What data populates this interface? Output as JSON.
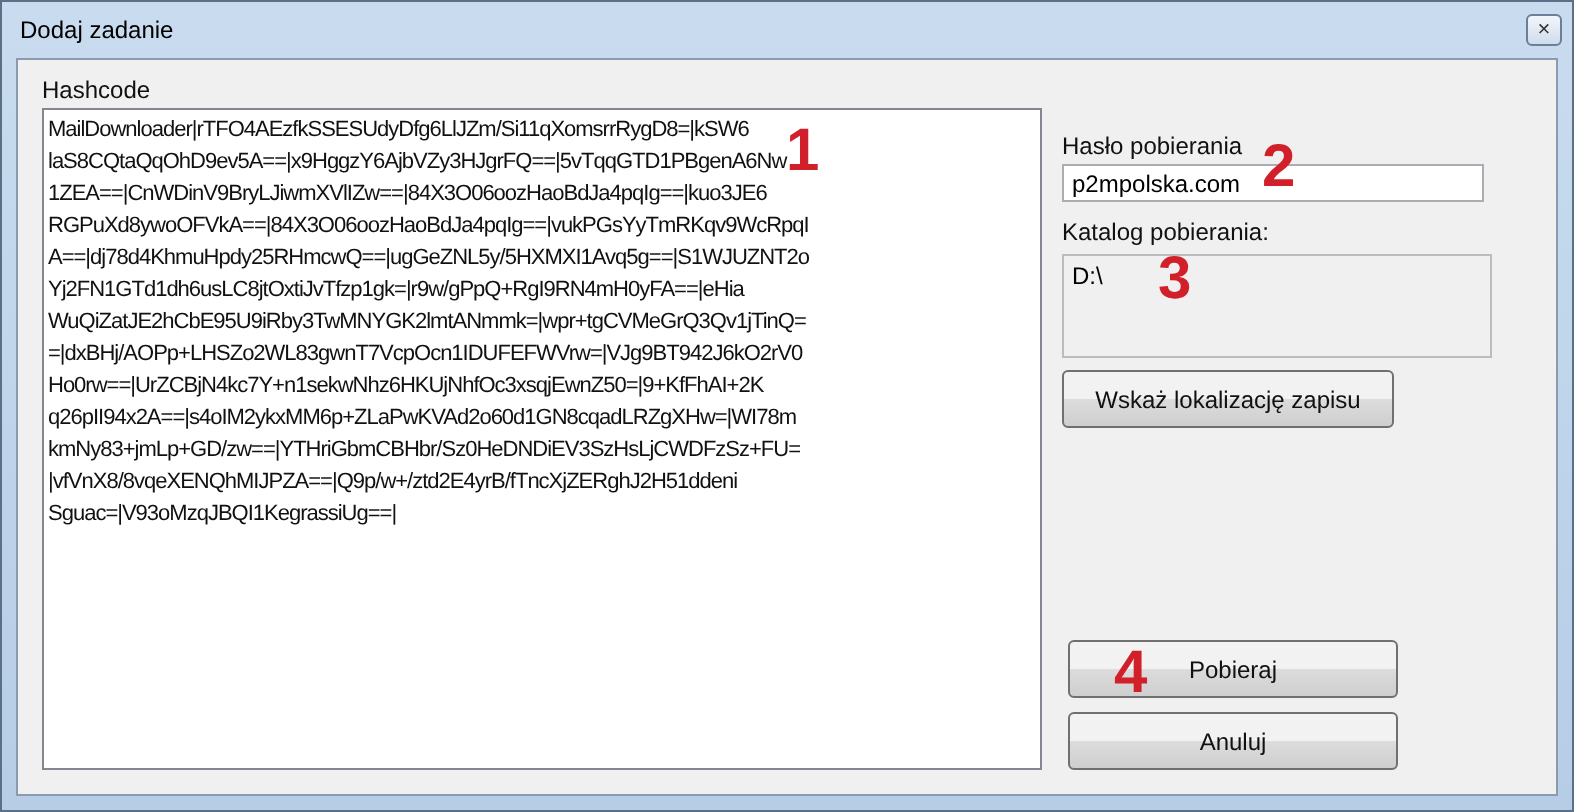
{
  "window": {
    "title": "Dodaj zadanie",
    "close": "×"
  },
  "hashcode": {
    "label": "Hashcode",
    "lines": [
      "MailDownloader|rTFO4AEzfkSSESUdyDfg6LlJZm/Si11qXomsrrRygD8=|kSW6",
      "laS8CQtaQqOhD9ev5A==|x9HggzY6AjbVZy3HJgrFQ==|5vTqqGTD1PBgenA6Nw",
      "1ZEA==|CnWDinV9BryLJiwmXVlIZw==|84X3O06oozHaoBdJa4pqIg==|kuo3JE6",
      "RGPuXd8ywoOFVkA==|84X3O06oozHaoBdJa4pqIg==|vukPGsYyTmRKqv9WcRpqI",
      "A==|dj78d4KhmuHpdy25RHmcwQ==|ugGeZNL5y/5HXMXI1Avq5g==|S1WJUZNT2o",
      "Yj2FN1GTd1dh6usLC8jtOxtiJvTfzp1gk=|r9w/gPpQ+RgI9RN4mH0yFA==|eHia",
      "WuQiZatJE2hCbE95U9iRby3TwMNYGK2lmtANmmk=|wpr+tgCVMeGrQ3Qv1jTinQ=",
      "=|dxBHj/AOPp+LHSZo2WL83gwnT7VcpOcn1IDUFEFWVrw=|VJg9BT942J6kO2rV0",
      "Ho0rw==|UrZCBjN4kc7Y+n1sekwNhz6HKUjNhfOc3xsqjEwnZ50=|9+KfFhAI+2K",
      "q26pII94x2A==|s4oIM2ykxMM6p+ZLaPwKVAd2o60d1GN8cqadLRZgXHw=|WI78m",
      "kmNy83+jmLp+GD/zw==|YTHriGbmCBHbr/Sz0HeDNDiEV3SzHsLjCWDFzSz+FU=",
      "|vfVnX8/8vqeXENQhMIJPZA==|Q9p/w+/ztd2E4yrB/fTncXjZERghJ2H51ddeni",
      "Sguac=|V93oMzqJBQI1KegrassiUg==|"
    ]
  },
  "password": {
    "label": "Hasło pobierania",
    "value": "p2mpolska.com"
  },
  "folder": {
    "label": "Katalog pobierania:",
    "value": "D:\\"
  },
  "buttons": [
    {
      "kind": "browse",
      "label": "Wskaż lokalizację zapisu"
    },
    {
      "kind": "download",
      "label": "Pobieraj"
    },
    {
      "kind": "cancel",
      "label": "Anuluj"
    }
  ],
  "annotations": [
    "1",
    "2",
    "3",
    "4"
  ]
}
